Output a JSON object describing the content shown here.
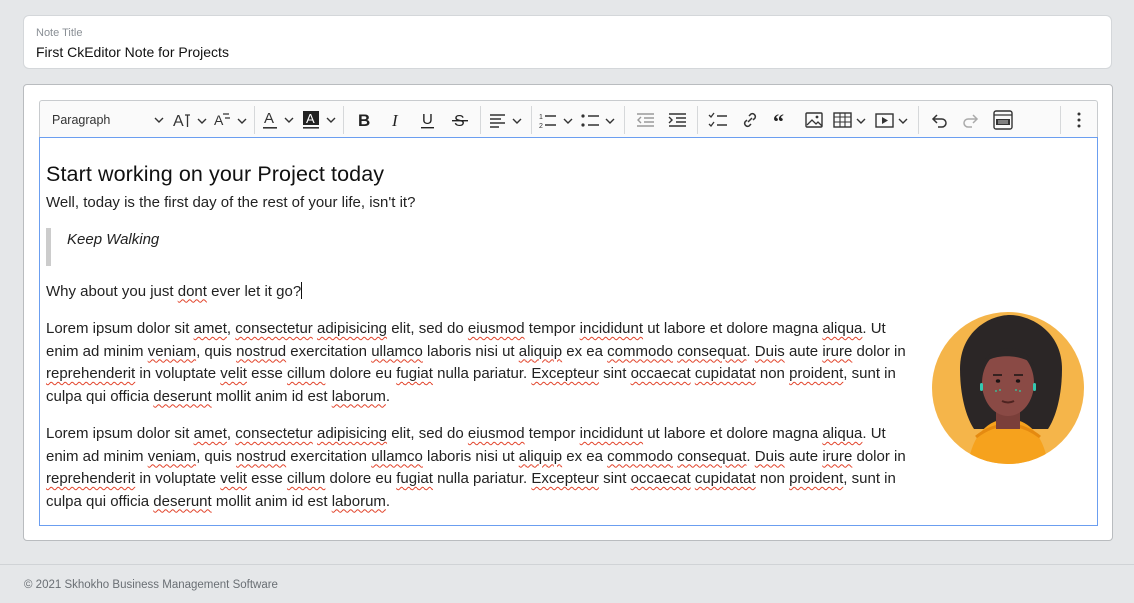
{
  "note_title": {
    "label": "Note Title",
    "value": "First CkEditor Note for Projects"
  },
  "toolbar": {
    "heading_dropdown": "Paragraph",
    "items": [
      "font-size-icon",
      "font-family-icon",
      "font-color-icon",
      "font-background-icon",
      "bold-icon",
      "italic-icon",
      "underline-icon",
      "strikethrough-icon",
      "align-icon",
      "numbered-list-icon",
      "bulleted-list-icon",
      "outdent-icon",
      "indent-icon",
      "todo-list-icon",
      "link-icon",
      "blockquote-icon",
      "image-icon",
      "table-icon",
      "media-icon",
      "undo-icon",
      "redo-icon",
      "html-embed-icon",
      "more-icon"
    ]
  },
  "content": {
    "heading": "Start working on your Project today",
    "intro": "Well, today is the first day of the rest of your life, isn't it?",
    "quote": "Keep Walking",
    "question_a": "Why about you just ",
    "question_b": "dont",
    "question_c": " ever let it go?"
  },
  "footer": {
    "text": "© 2021 Skhokho Business Management Software"
  },
  "colors": {
    "focus_border": "#6b9ef0",
    "spell_underline": "#e2432a",
    "avatar_bg": "#f5b54a"
  }
}
